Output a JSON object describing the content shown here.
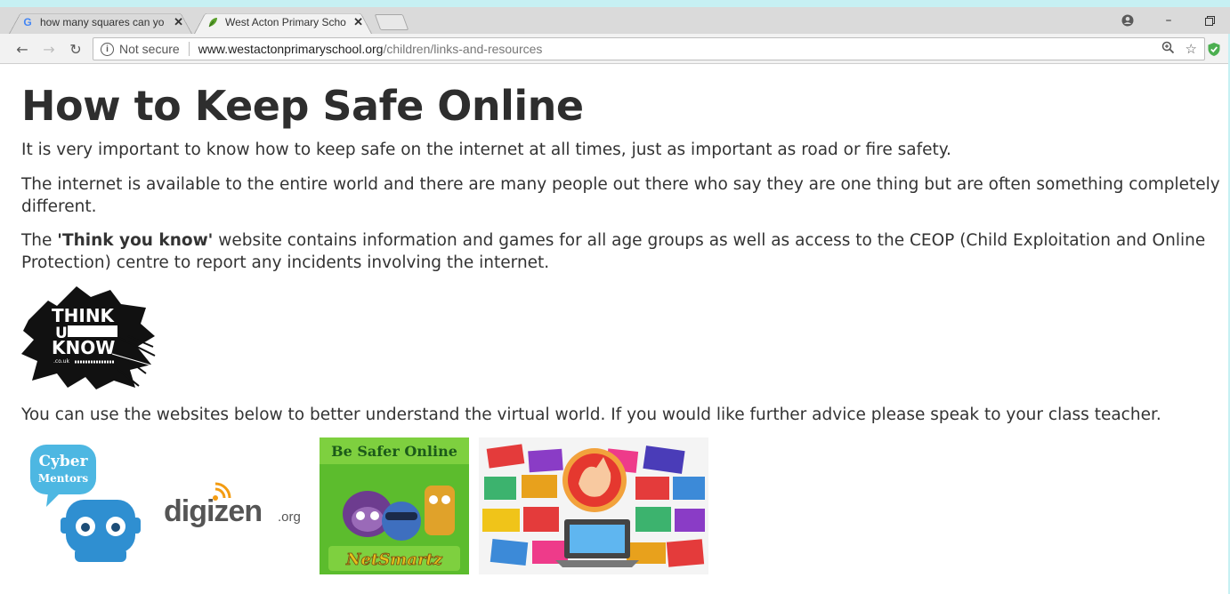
{
  "browser": {
    "tabs": [
      {
        "title": "how many squares can yo",
        "favicon": "google-g-icon",
        "active": false
      },
      {
        "title": "West Acton Primary Scho",
        "favicon": "school-leaf-icon",
        "active": true
      }
    ],
    "address": {
      "security_label": "Not secure",
      "host": "www.westactonprimaryschool.org",
      "path": "/children/links-and-resources"
    }
  },
  "page": {
    "heading": "How to Keep Safe Online",
    "para1": "It is very important to know how to keep safe on the internet at all times, just as important as road or fire safety.",
    "para2": "The internet is available to the entire world and there are many people out there who say they are one thing but are often something completely different.",
    "para3_before": "The ",
    "para3_bold": "'Think you know'",
    "para3_after": " website contains information and games for all age groups as well as access to the CEOP (Child Exploitation and Online Protection) centre to report any incidents involving the internet.",
    "para4": "You can use the websites below to better understand the virtual world. If you would like further advice please speak to your class teacher.",
    "logos": {
      "thinkuknow": {
        "line1": "THINK",
        "line2": "U",
        "line3": "KNOW",
        "domain": ".co.uk"
      },
      "cybermentors": {
        "line1": "Cyber",
        "line2": "Mentors"
      },
      "digizen": {
        "name": "digizen",
        "tld": ".org"
      },
      "netsmartz": {
        "top": "Be Safer Online",
        "bottom": "NetSmartz"
      }
    }
  },
  "colors": {
    "frame": "#c6f0f3",
    "text": "#333333",
    "cyber": "#3fa9d6",
    "netsmartz_green": "#5bbd2b"
  }
}
